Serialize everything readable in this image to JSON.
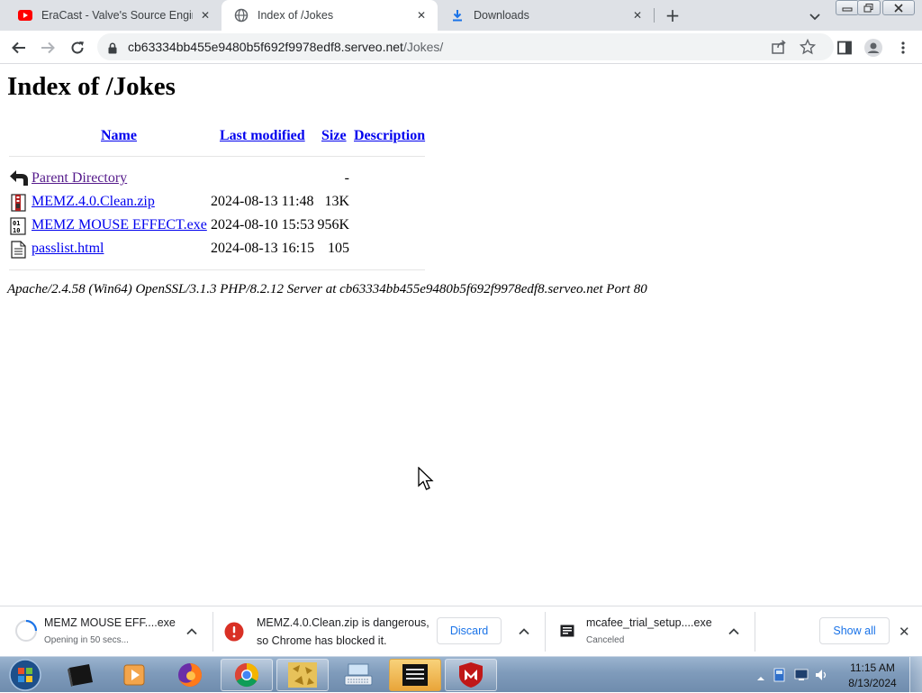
{
  "browser": {
    "tabs": [
      {
        "title": "EraCast - Valve's Source Engine -",
        "favicon": "youtube-icon",
        "active": false
      },
      {
        "title": "Index of /Jokes",
        "favicon": "globe-icon",
        "active": true
      },
      {
        "title": "Downloads",
        "favicon": "download-icon",
        "active": false
      }
    ],
    "new_tab_label": "+",
    "close_glyph": "✕",
    "omnibox": {
      "domain": "cb63334bb455e9480b5f692f9978edf8.serveo.net",
      "path": "/Jokes/"
    }
  },
  "page": {
    "title": "Index of /Jokes",
    "columns": {
      "name": "Name",
      "last_modified": "Last modified",
      "size": "Size",
      "description": "Description"
    },
    "rows": [
      {
        "name": "Parent Directory",
        "date": "",
        "size": "-",
        "icon": "back-arrow-icon",
        "visited": true
      },
      {
        "name": "MEMZ.4.0.Clean.zip",
        "date": "2024-08-13 11:48",
        "size": "13K",
        "icon": "compressed-file-icon",
        "visited": false
      },
      {
        "name": "MEMZ MOUSE EFFECT.exe",
        "date": "2024-08-10 15:53",
        "size": "956K",
        "icon": "binary-file-icon",
        "visited": false
      },
      {
        "name": "passlist.html",
        "date": "2024-08-13 16:15",
        "size": "105",
        "icon": "text-file-icon",
        "visited": false
      }
    ],
    "server_signature": "Apache/2.4.58 (Win64) OpenSSL/3.1.3 PHP/8.2.12 Server at cb63334bb455e9480b5f692f9978edf8.serveo.net Port 80"
  },
  "downloads": {
    "items": [
      {
        "name": "MEMZ MOUSE EFF....exe",
        "status": "Opening in 50 secs...",
        "icon": "progress-spinner-icon"
      },
      {
        "name_line1": "MEMZ.4.0.Clean.zip is dangerous,",
        "name_line2": "so Chrome has blocked it.",
        "action": "Discard",
        "icon": "danger-icon"
      },
      {
        "name": "mcafee_trial_setup....exe",
        "status": "Canceled",
        "icon": "installer-file-icon"
      }
    ],
    "show_all": "Show all",
    "close_glyph": "✕"
  },
  "taskbar": {
    "apps": [
      "start-orb-icon",
      "terminal-app-icon",
      "media-player-icon",
      "firefox-icon",
      "chrome-icon",
      "file-manager-icon",
      "keyboard-app-icon",
      "console-app-icon",
      "mcafee-icon"
    ],
    "clock": {
      "time": "11:15 AM",
      "date": "8/13/2024"
    }
  },
  "colors": {
    "link": "#0000ee",
    "visited_link": "#551a8b",
    "chrome_blue": "#1a73e8",
    "danger_red": "#d93025"
  }
}
